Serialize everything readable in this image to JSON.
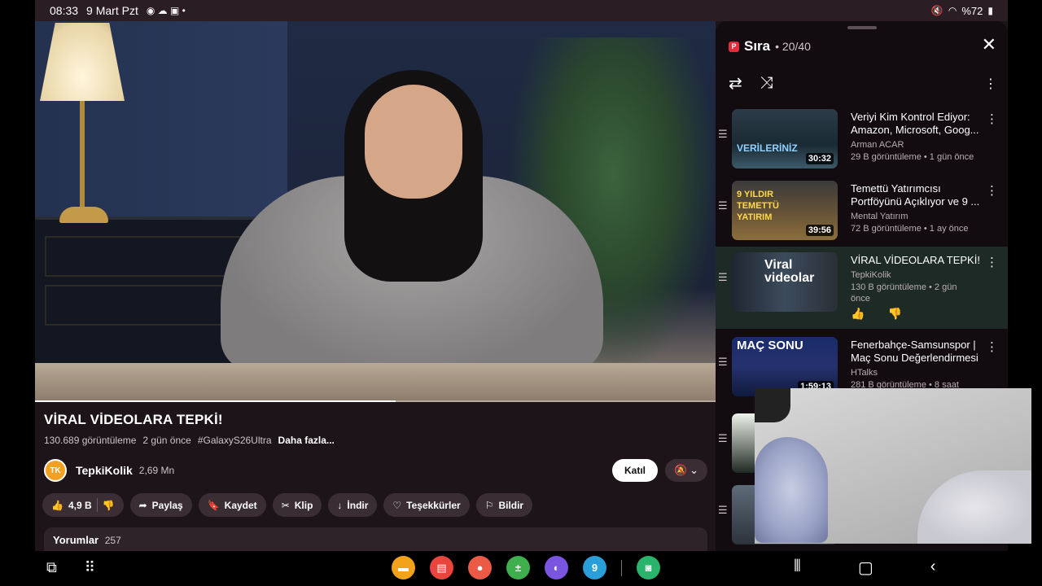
{
  "status_bar": {
    "time": "08:33",
    "date": "9 Mart Pzt",
    "battery": "%72"
  },
  "video": {
    "progress_fraction": 0.53,
    "title": "VİRAL VİDEOLARA TEPKİ!",
    "views": "130.689 görüntüleme",
    "age": "2 gün önce",
    "hashtag": "#GalaxyS26Ultra",
    "more": "Daha fazla...",
    "channel": {
      "avatar_text": "TK",
      "name": "TepkiKolik",
      "subscribers": "2,69 Mn",
      "join_label": "Katıl"
    },
    "actions": {
      "likes": "4,9 B",
      "share": "Paylaş",
      "save": "Kaydet",
      "clip": "Klip",
      "download": "İndir",
      "thanks": "Teşekkürler",
      "report": "Bildir"
    },
    "comments": {
      "label": "Yorumlar",
      "count": "257"
    }
  },
  "queue": {
    "logo": "P",
    "title": "Sıra",
    "position": "• 20/40",
    "items": [
      {
        "title": "Veriyi Kim Kontrol Ediyor: Amazon, Microsoft, Goog...",
        "channel": "Arman ACAR",
        "stats": "29 B görüntüleme • 1 gün önce",
        "duration": "30:32",
        "thumb_text": "VERİLERİNİZ"
      },
      {
        "title": "Temettü Yatırımcısı Portföyünü Açıklıyor ve 9 ...",
        "channel": "Mental Yatırım",
        "stats": "72 B görüntüleme • 1 ay önce",
        "duration": "39:56",
        "thumb_text": "9 YILDIR TEMETTÜ YATIRIM"
      },
      {
        "title": "VİRAL VİDEOLARA TEPKİ!",
        "channel": "TepkiKolik",
        "stats": "130 B görüntüleme • 2 gün önce",
        "duration": "",
        "thumb_text": "Viral videolar"
      },
      {
        "title": "Fenerbahçe-Samsunspor | Maç Sonu Değerlendirmesi",
        "channel": "HTalks",
        "stats": "281 B görüntüleme • 8 saat",
        "duration": "1:59:13",
        "thumb_text": "MAÇ SONU"
      }
    ]
  },
  "dock": {
    "calendar_day": "9"
  }
}
